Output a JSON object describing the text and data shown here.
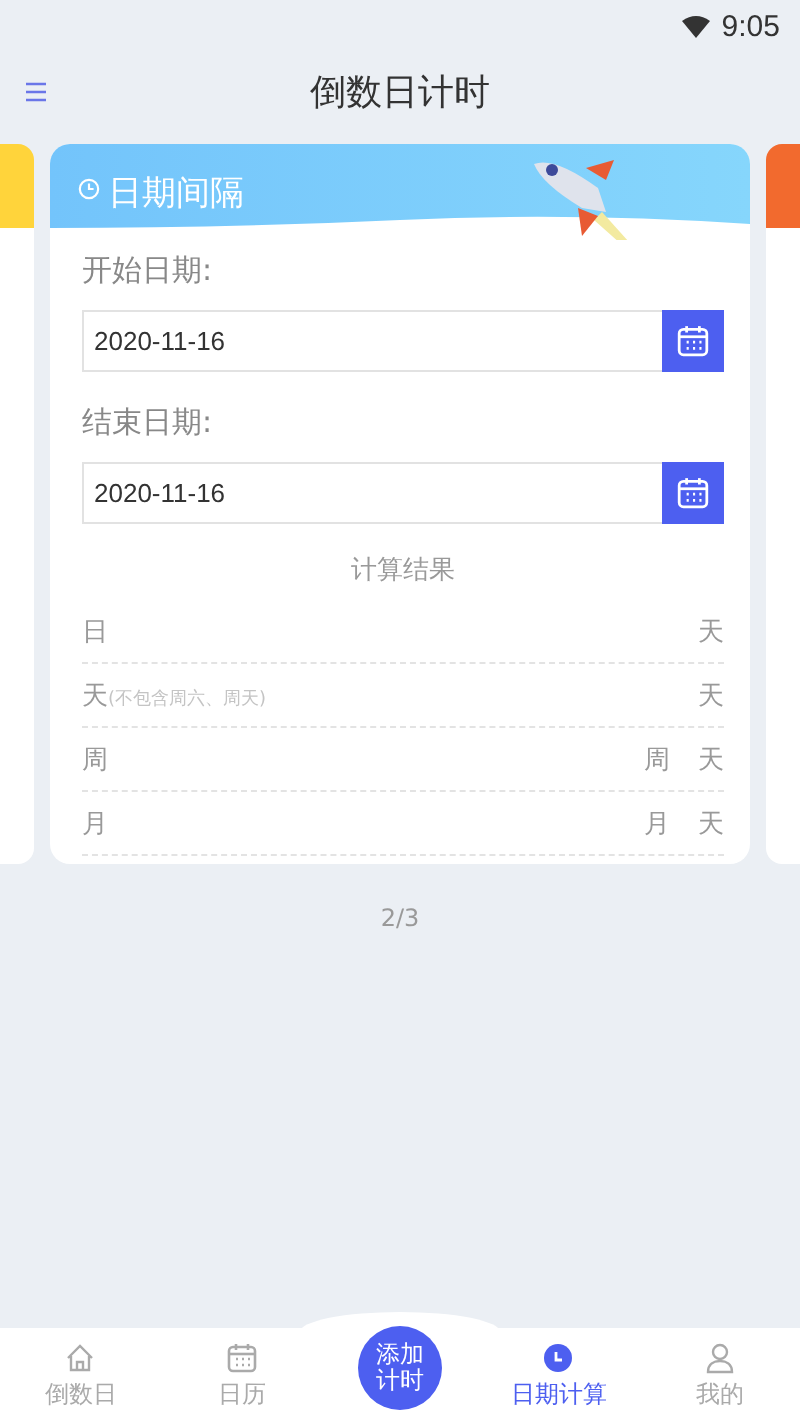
{
  "status_bar": {
    "time": "9:05"
  },
  "header": {
    "title": "倒数日计时"
  },
  "card": {
    "title": "日期间隔",
    "fields": [
      {
        "label": "开始日期:",
        "value": "2020-11-16"
      },
      {
        "label": "结束日期:",
        "value": "2020-11-16"
      }
    ],
    "result_title": "计算结果",
    "results": [
      {
        "label": "日",
        "units": [
          "天"
        ]
      },
      {
        "label": "天",
        "note": "(不包含周六、周天)",
        "units": [
          "天"
        ]
      },
      {
        "label": "周",
        "units": [
          "周",
          "天"
        ]
      },
      {
        "label": "月",
        "units": [
          "月",
          "天"
        ]
      }
    ]
  },
  "pager": "2/3",
  "nav": [
    {
      "kind": "tab",
      "label": "倒数日",
      "selected": false
    },
    {
      "kind": "tab",
      "label": "日历",
      "selected": false
    },
    {
      "kind": "add",
      "label": "添加计时"
    },
    {
      "kind": "tab",
      "label": "日期计算",
      "selected": true
    },
    {
      "kind": "tab",
      "label": "我的",
      "selected": false
    }
  ]
}
